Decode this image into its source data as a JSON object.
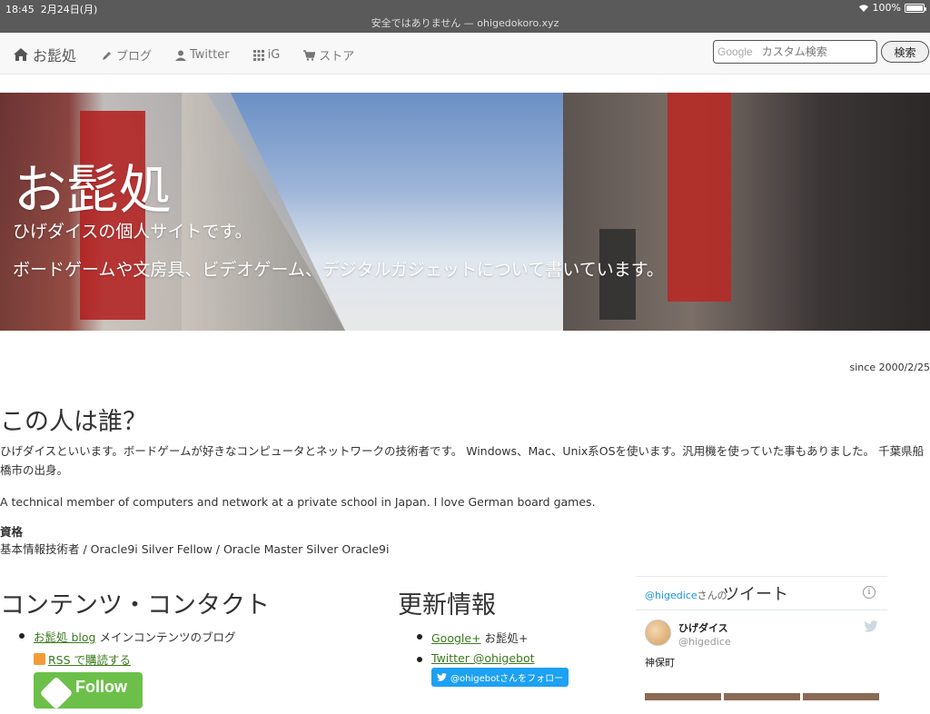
{
  "status": {
    "time": "18:45",
    "date": "2月24日(月)",
    "battery": "100%",
    "battery_level": 1.0
  },
  "url": {
    "text": "安全ではありません — ohigedokoro.xyz"
  },
  "nav": {
    "brand": "お髭処",
    "items": [
      {
        "label": "ブログ",
        "icon": "pencil-icon"
      },
      {
        "label": "Twitter",
        "icon": "user-icon"
      },
      {
        "label": "iG",
        "icon": "grid-icon"
      },
      {
        "label": "ストア",
        "icon": "cart-icon"
      }
    ],
    "search_brand": "Google",
    "search_placeholder": "カスタム検索",
    "search_button": "検索"
  },
  "hero": {
    "title": "お髭処",
    "subtitle1": "ひげダイスの個人サイトです。",
    "subtitle2": "ボードゲームや文房具、ビデオゲーム、デジタルガジェットについて書いています。"
  },
  "since": "since 2000/2/25",
  "about": {
    "heading": "この人は誰？",
    "jp": "ひげダイスといいます。ボードゲームが好きなコンピュータとネットワークの技術者です。 Windows、Mac、Unix系OSを使います。汎用機を使っていた事もありました。 千葉県船橋市の出身。",
    "en": "A technical member of computers and network at a private school in Japan. I love German board games.",
    "cert_heading": "資格",
    "certs": "基本情報技術者 / Oracle9i Silver Fellow / Oracle Master Silver Oracle9i"
  },
  "contents": {
    "heading": "コンテンツ・コンタクト",
    "blog_link": "お髭処 blog",
    "blog_desc": " メインコンテンツのブログ",
    "rss": "RSS で購読する",
    "feedly": "Follow"
  },
  "updates": {
    "heading": "更新情報",
    "google_link": "Google+",
    "google_desc": " お髭処+",
    "twitter_link": "Twitter @ohigebot",
    "follow_btn": "@ohigebotさんをフォロー"
  },
  "tweets": {
    "handle": "@higedice",
    "san": "さんの",
    "title": "ツイート",
    "name": "ひげダイス",
    "screen": "@higedice",
    "text": "神保町"
  }
}
